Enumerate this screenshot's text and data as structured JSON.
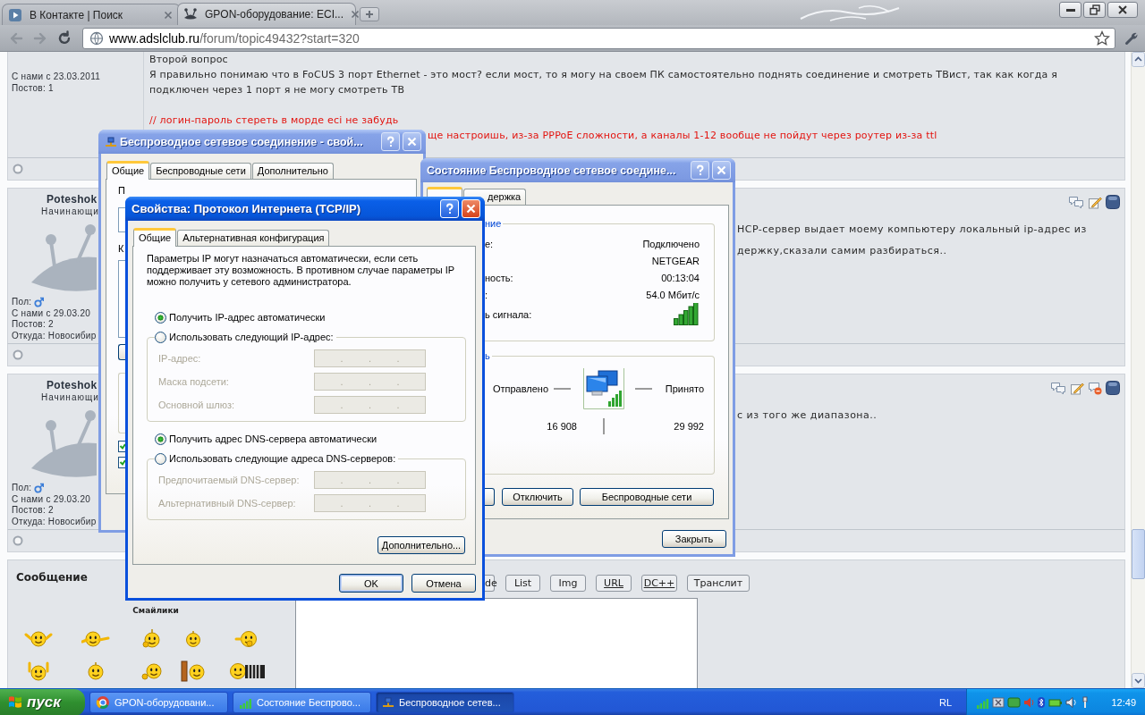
{
  "browser": {
    "tabs": [
      {
        "title": "В Контакте | Поиск",
        "selected": false
      },
      {
        "title": "GPON-оборудование: ECI...",
        "selected": true
      }
    ],
    "nav": [
      {
        "kind": "back",
        "disabled": true
      },
      {
        "kind": "forward",
        "disabled": true
      },
      {
        "kind": "reload",
        "disabled": false
      }
    ],
    "address": {
      "host": "www.adslclub.ru",
      "path": "/forum/topic49432?start=320"
    }
  },
  "forum": {
    "posts": [
      {
        "user": {
          "joined": "С нами с 23.03.2011",
          "count": "Постов: 1"
        },
        "lines": [
          {
            "kind": "text",
            "text": "Второй вопрос"
          },
          {
            "kind": "text",
            "text": "Я правильно понимаю что в FoCUS 3 порт Ethernet - это мост? если мост, то я могу на своем ПК самостоятельно поднять соединение и смотреть ТВист, так как когда я подключен через 1 порт я не могу смотреть ТВ"
          },
          {
            "kind": "comment",
            "text": "// логин-пароль стереть в морде eci не забудь"
          }
        ],
        "tail_lines": [
          {
            "kind": "comment",
            "text": "ще настроишь, из-за PPPoE сложности, а каналы 1-12 вообще не пойдут через роутер из-за ttl"
          }
        ]
      },
      {
        "user": {
          "name": "Poteshok",
          "rank": "Начинающи",
          "gender_label": "Пол:",
          "joined": "С нами с 29.03.20",
          "count": "Постов: 2",
          "from": "Откуда: Новосибир"
        },
        "actions": [
          {
            "kind": "quote"
          },
          {
            "kind": "edit"
          },
          {
            "kind": "profile"
          }
        ],
        "tail_lines": [
          {
            "kind": "text",
            "text": "HCP-сервер выдает моему компьютеру локальный ip-адрес из"
          },
          {
            "kind": "text",
            "text": "держку,сказали самим разбираться.."
          }
        ]
      },
      {
        "user": {
          "name": "Poteshok",
          "rank": "Начинающи",
          "gender_label": "Пол:",
          "joined": "С нами с 29.03.20",
          "count": "Постов: 2",
          "from": "Откуда: Новосибир"
        },
        "actions": [
          {
            "kind": "quote"
          },
          {
            "kind": "edit"
          },
          {
            "kind": "report"
          },
          {
            "kind": "profile"
          }
        ],
        "tail_lines": [
          {
            "kind": "text",
            "text": "с из того же диапазона.."
          }
        ]
      }
    ],
    "reply": {
      "title": "Сообщение",
      "smileys_title": "Смайлики",
      "bbcode": [
        {
          "label": "de",
          "cut": true,
          "underlined": false
        },
        {
          "label": "List",
          "cut": false,
          "underlined": false
        },
        {
          "label": "Img",
          "cut": false,
          "underlined": false
        },
        {
          "label": "URL",
          "cut": false,
          "underlined": true
        },
        {
          "label": "DC++",
          "cut": false,
          "underlined": true
        },
        {
          "label": "Транслит",
          "cut": false,
          "underlined": false
        }
      ]
    }
  },
  "wireless_properties": {
    "title": "Беспроводное сетевое соединение - свой...",
    "active": false,
    "tabs": [
      {
        "label": "Общие",
        "selected": true
      },
      {
        "label": "Беспроводные сети",
        "selected": false
      },
      {
        "label": "Дополнительно",
        "selected": false
      }
    ],
    "labels": [
      "П",
      "К"
    ],
    "checkboxes": [
      {
        "checked": true
      },
      {
        "checked": true
      }
    ]
  },
  "connection_status": {
    "title": "Состояние Беспроводное сетевое соедине...",
    "active": false,
    "tabs": [
      {
        "selected": true
      },
      {
        "label": "держка",
        "selected": false
      }
    ],
    "connection": {
      "legend": "ние",
      "rows": [
        {
          "kind": "text",
          "label": "е:",
          "value": "Подключено"
        },
        {
          "kind": "text",
          "value": "NETGEAR"
        },
        {
          "kind": "text",
          "label": "ность:",
          "value": "00:13:04"
        },
        {
          "kind": "text",
          "label": ":",
          "value": "54.0 Мбит/с"
        },
        {
          "kind": "signal",
          "label": "ь сигнала:"
        }
      ]
    },
    "activity": {
      "legend": "ь",
      "sent_label": "Отправлено",
      "received_label": "Принято",
      "sent": "16 908",
      "received": "29 992"
    },
    "buttons": [
      "Отключить",
      "Беспроводные сети"
    ],
    "close": "Закрыть"
  },
  "tcpip_properties": {
    "title": "Свойства: Протокол Интернета (TCP/IP)",
    "active": true,
    "tabs": [
      {
        "label": "Общие",
        "selected": true
      },
      {
        "label": "Альтернативная конфигурация",
        "selected": false
      }
    ],
    "intro": "Параметры IP могут назначаться автоматически, если сеть поддерживает эту возможность. В противном случае параметры IP можно получить у сетевого администратора.",
    "separator": ".",
    "sections": [
      {
        "options": [
          {
            "label": "Получить IP-адрес автоматически",
            "selected": true
          },
          {
            "label": "Использовать следующий IP-адрес:",
            "selected": false
          }
        ],
        "fields": [
          {
            "label": "IP-адрес:",
            "disabled": true
          },
          {
            "label": "Маска подсети:",
            "disabled": true
          },
          {
            "label": "Основной шлюз:",
            "disabled": true
          }
        ]
      },
      {
        "options": [
          {
            "label": "Получить адрес DNS-сервера автоматически",
            "selected": true
          },
          {
            "label": "Использовать следующие адреса DNS-серверов:",
            "selected": false
          }
        ],
        "fields": [
          {
            "label": "Предпочитаемый DNS-сервер:",
            "disabled": true
          },
          {
            "label": "Альтернативный DNS-сервер:",
            "disabled": true
          }
        ]
      }
    ],
    "advanced": "Дополнительно...",
    "buttons": [
      {
        "label": "OK",
        "default": true
      },
      {
        "label": "Отмена",
        "default": false
      }
    ]
  },
  "taskbar": {
    "start": "пуск",
    "tasks": [
      {
        "kind": "browser",
        "title": "GPON-оборудовани...",
        "selected": false
      },
      {
        "kind": "signal",
        "title": "Состояние Беспрово...",
        "selected": false
      },
      {
        "kind": "network",
        "title": "Беспроводное сетев...",
        "selected": true
      }
    ],
    "language": "RL",
    "clock": "12:49"
  }
}
